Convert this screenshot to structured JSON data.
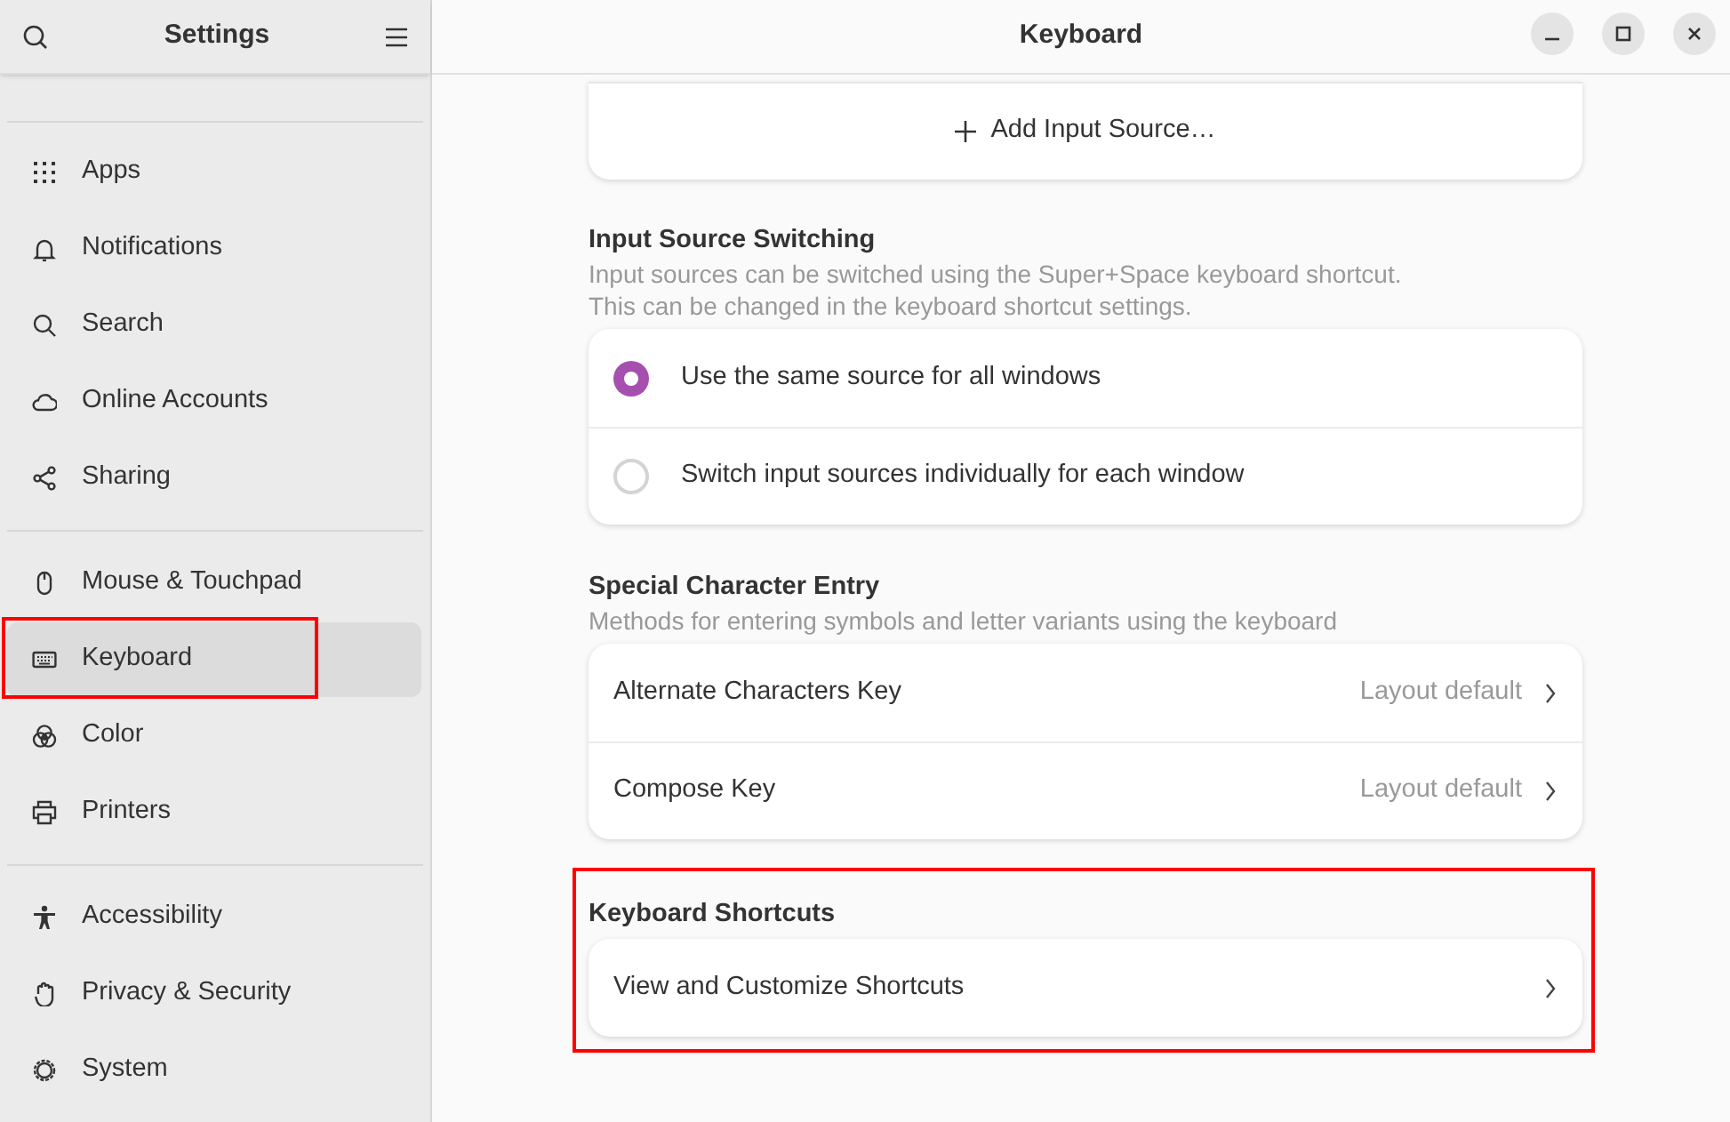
{
  "sidebar": {
    "title": "Settings",
    "groups": [
      {
        "items": [
          {
            "label": "Apps",
            "selected": false,
            "outlined": false
          },
          {
            "label": "Notifications",
            "selected": false,
            "outlined": false
          },
          {
            "label": "Search",
            "selected": false,
            "outlined": false
          },
          {
            "label": "Online Accounts",
            "selected": false,
            "outlined": false
          },
          {
            "label": "Sharing",
            "selected": false,
            "outlined": false
          }
        ]
      },
      {
        "items": [
          {
            "label": "Mouse & Touchpad",
            "selected": false,
            "outlined": false
          },
          {
            "label": "Keyboard",
            "selected": true,
            "outlined": true
          },
          {
            "label": "Color",
            "selected": false,
            "outlined": false
          },
          {
            "label": "Printers",
            "selected": false,
            "outlined": false
          }
        ]
      },
      {
        "items": [
          {
            "label": "Accessibility",
            "selected": false,
            "outlined": false
          },
          {
            "label": "Privacy & Security",
            "selected": false,
            "outlined": false
          },
          {
            "label": "System",
            "selected": false,
            "outlined": false
          }
        ]
      }
    ]
  },
  "window": {
    "title": "Keyboard"
  },
  "add_input_source": "Add Input Source…",
  "sections": [
    {
      "kind": "radio",
      "title": "Input Source Switching",
      "description": [
        "Input sources can be switched using the Super+Space keyboard shortcut.",
        "This can be changed in the keyboard shortcut settings."
      ],
      "outlined": false,
      "rows": [
        {
          "label": "Use the same source for all windows",
          "selected": true
        },
        {
          "label": "Switch input sources individually for each window",
          "selected": false
        }
      ]
    },
    {
      "kind": "link",
      "title": "Special Character Entry",
      "description": [
        "Methods for entering symbols and letter variants using the keyboard"
      ],
      "outlined": false,
      "rows": [
        {
          "label": "Alternate Characters Key",
          "value": "Layout default"
        },
        {
          "label": "Compose Key",
          "value": "Layout default"
        }
      ]
    },
    {
      "kind": "link",
      "title": "Keyboard Shortcuts",
      "outlined": true,
      "rows": [
        {
          "label": "View and Customize Shortcuts"
        }
      ]
    }
  ]
}
